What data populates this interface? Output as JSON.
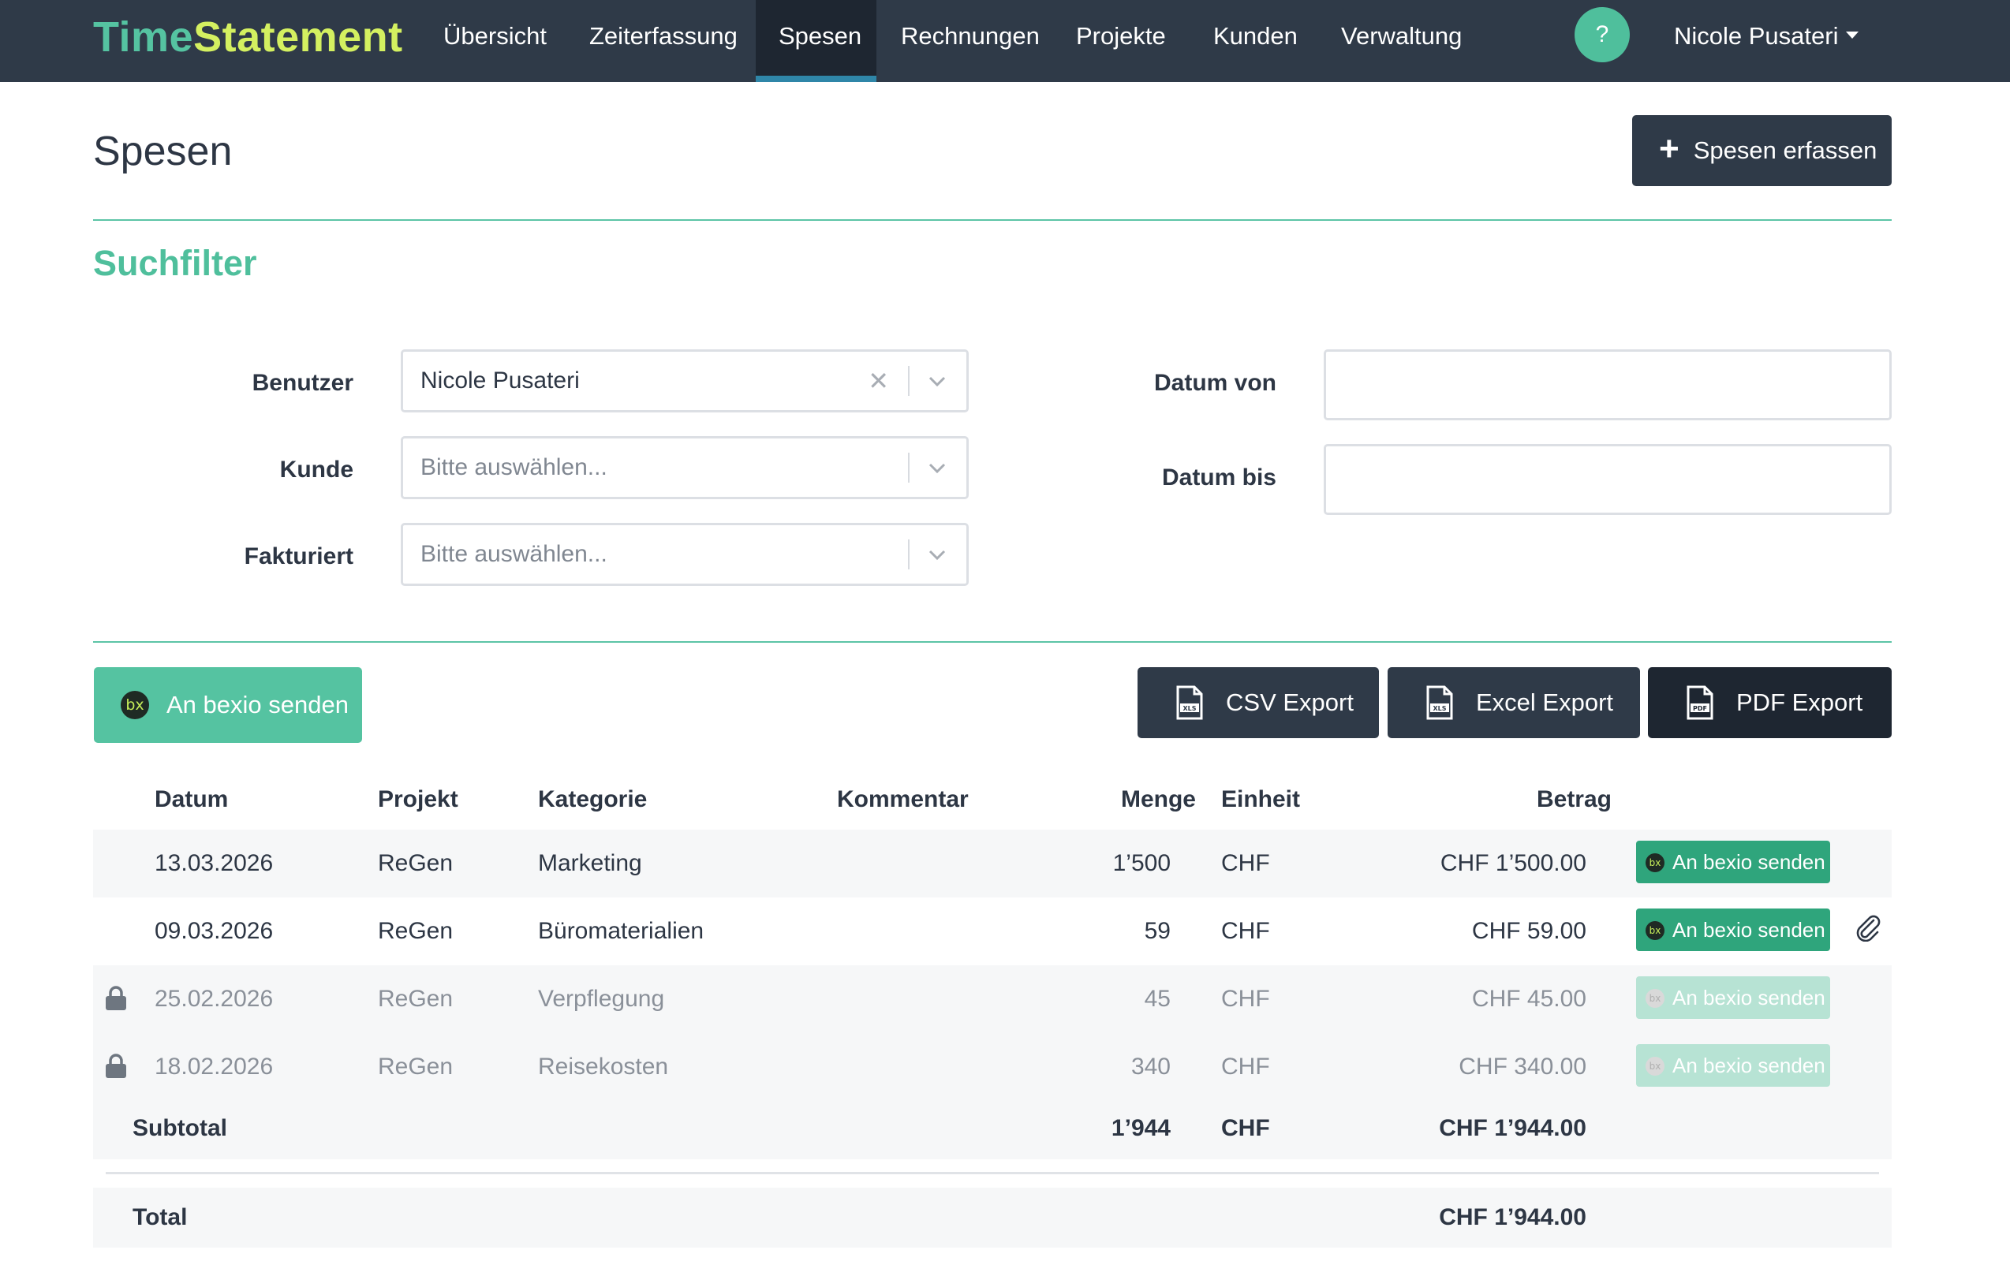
{
  "brand": {
    "part1": "Time",
    "part2": "Statement"
  },
  "nav": {
    "items": [
      {
        "label": "Übersicht"
      },
      {
        "label": "Zeiterfassung"
      },
      {
        "label": "Spesen",
        "active": true
      },
      {
        "label": "Rechnungen"
      },
      {
        "label": "Projekte"
      },
      {
        "label": "Kunden"
      },
      {
        "label": "Verwaltung"
      }
    ],
    "help_label": "?",
    "user_name": "Nicole Pusateri"
  },
  "page": {
    "title": "Spesen",
    "add_button_label": "Spesen erfassen"
  },
  "filter": {
    "title": "Suchfilter",
    "user_label": "Benutzer",
    "user_value": "Nicole Pusateri",
    "customer_label": "Kunde",
    "customer_placeholder": "Bitte auswählen...",
    "invoiced_label": "Fakturiert",
    "invoiced_placeholder": "Bitte auswählen...",
    "date_from_label": "Datum von",
    "date_from_value": "",
    "date_to_label": "Datum bis",
    "date_to_value": ""
  },
  "actions": {
    "bexio_label": "An bexio senden",
    "bexio_badge": "bx",
    "csv_label": "CSV Export",
    "excel_label": "Excel Export",
    "pdf_label": "PDF Export",
    "xls_tag": "XLS",
    "pdf_tag": "PDF"
  },
  "table": {
    "columns": {
      "date": "Datum",
      "project": "Projekt",
      "category": "Kategorie",
      "comment": "Kommentar",
      "quantity": "Menge",
      "unit": "Einheit",
      "amount": "Betrag"
    },
    "row_button_label": "An bexio senden",
    "rows": [
      {
        "date": "13.03.2026",
        "project": "ReGen",
        "category": "Marketing",
        "comment": "",
        "quantity": "1’500",
        "unit": "CHF",
        "amount": "CHF 1’500.00",
        "locked": false,
        "attachment": false
      },
      {
        "date": "09.03.2026",
        "project": "ReGen",
        "category": "Büromaterialien",
        "comment": "",
        "quantity": "59",
        "unit": "CHF",
        "amount": "CHF 59.00",
        "locked": false,
        "attachment": true
      },
      {
        "date": "25.02.2026",
        "project": "ReGen",
        "category": "Verpflegung",
        "comment": "",
        "quantity": "45",
        "unit": "CHF",
        "amount": "CHF 45.00",
        "locked": true,
        "attachment": false
      },
      {
        "date": "18.02.2026",
        "project": "ReGen",
        "category": "Reisekosten",
        "comment": "",
        "quantity": "340",
        "unit": "CHF",
        "amount": "CHF 340.00",
        "locked": true,
        "attachment": false
      }
    ],
    "subtotal": {
      "label": "Subtotal",
      "quantity": "1’944",
      "unit": "CHF",
      "amount": "CHF 1’944.00"
    },
    "total": {
      "label": "Total",
      "amount": "CHF 1’944.00"
    }
  },
  "colors": {
    "navbar": "#2f3a48",
    "accent_green": "#55c3a1",
    "brand_yellow": "#d4f060",
    "row_button": "#2fa57c",
    "row_button_disabled": "#b7e3d4"
  }
}
